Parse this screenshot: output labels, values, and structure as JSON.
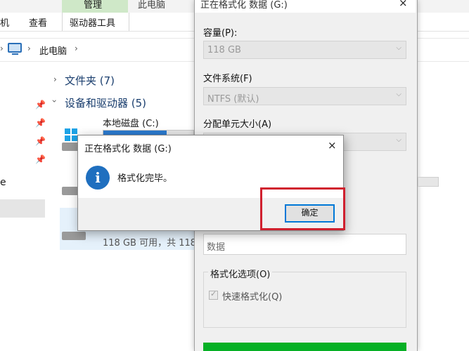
{
  "explorer": {
    "ribbon_tabs": {
      "partial_left": "机",
      "view": "查看",
      "manage": "管理",
      "drive_tools": "驱动器工具",
      "partial_right": "此电脑"
    },
    "address": {
      "location": "此电脑",
      "chevron": "›"
    },
    "sidebar": {
      "partial_label": "e",
      "pin_glyph": "📌"
    },
    "groups": {
      "folders": "文件夹 (7)",
      "devices": "设备和驱动器 (5)"
    },
    "drives": {
      "local_c": "本地磁盘 (C:)",
      "selected_free": "118 GB 可用，共 118"
    }
  },
  "format_dialog": {
    "title": "正在格式化 数据 (G:)",
    "close_glyph": "×",
    "capacity": {
      "label": "容量(P):",
      "value": "118 GB"
    },
    "filesystem": {
      "label": "文件系统(F)",
      "value": "NTFS (默认)"
    },
    "allocation": {
      "label": "分配单元大小(A)"
    },
    "volume_label_value": "数据",
    "options": {
      "title": "格式化选项(O)",
      "quick_format": "快速格式化(Q)"
    },
    "combo_arrow": "⌵"
  },
  "message_box": {
    "title": "正在格式化 数据 (G:)",
    "close_glyph": "×",
    "icon_glyph": "i",
    "message": "格式化完毕。",
    "ok_label": "确定"
  }
}
